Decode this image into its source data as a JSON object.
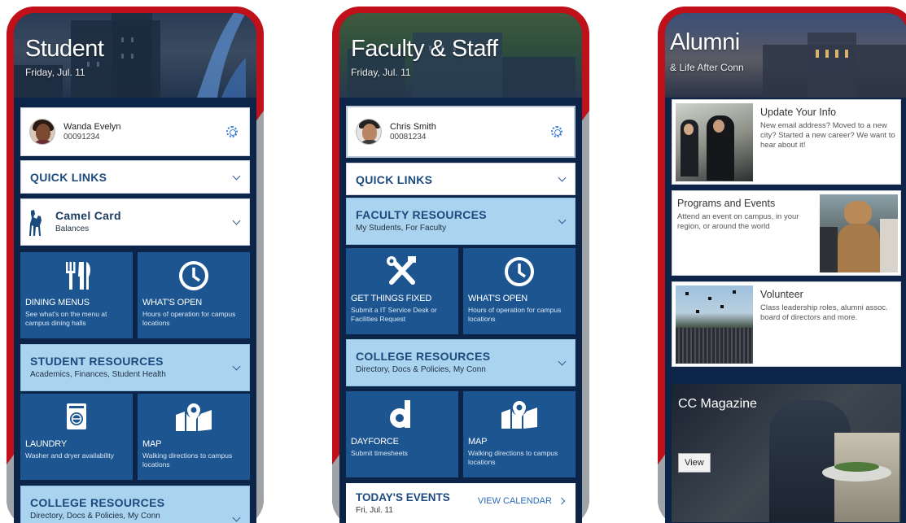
{
  "student": {
    "title": "Student",
    "date": "Friday, Jul. 11",
    "profile": {
      "name": "Wanda Evelyn",
      "id": "00091234"
    },
    "quick_links": "QUICK LINKS",
    "camel_card": {
      "title": "Camel Card",
      "subtitle": "Balances"
    },
    "tiles_top": [
      {
        "icon": "fork-knife-icon",
        "label": "DINING MENUS",
        "desc": "See what's on the menu at campus dining halls"
      },
      {
        "icon": "clock-icon",
        "label": "WHAT'S OPEN",
        "desc": "Hours of operation for campus locations"
      }
    ],
    "student_resources": {
      "title": "STUDENT RESOURCES",
      "subtitle": "Academics, Finances, Student Health"
    },
    "tiles_bottom": [
      {
        "icon": "washing-machine-icon",
        "label": "LAUNDRY",
        "desc": "Washer and dryer availability"
      },
      {
        "icon": "map-pin-icon",
        "label": "MAP",
        "desc": "Walking directions to campus locations"
      }
    ],
    "college_resources": {
      "title": "COLLEGE RESOURCES",
      "subtitle": "Directory, Docs & Policies, My Conn"
    }
  },
  "faculty": {
    "title": "Faculty & Staff",
    "date": "Friday, Jul. 11",
    "profile": {
      "name": "Chris Smith",
      "id": "00081234"
    },
    "quick_links": "QUICK LINKS",
    "faculty_resources": {
      "title": "FACULTY RESOURCES",
      "subtitle": "My Students, For Faculty"
    },
    "tiles_top": [
      {
        "icon": "wrench-screwdriver-icon",
        "label": "GET THINGS FIXED",
        "desc": "Submit a IT Service Desk or Facilities Request"
      },
      {
        "icon": "clock-icon",
        "label": "WHAT'S OPEN",
        "desc": "Hours of operation for campus locations"
      }
    ],
    "college_resources": {
      "title": "COLLEGE RESOURCES",
      "subtitle": "Directory, Docs & Policies, My Conn"
    },
    "tiles_bottom": [
      {
        "icon": "dayforce-logo-icon",
        "label": "DAYFORCE",
        "desc": "Submit timesheets"
      },
      {
        "icon": "map-pin-icon",
        "label": "MAP",
        "desc": "Walking directions to campus locations"
      }
    ],
    "events": {
      "title": "TODAY'S EVENTS",
      "date": "Fri, Jul. 11",
      "link": "VIEW CALENDAR"
    }
  },
  "alumni": {
    "title": "Alumni",
    "subtitle": "& Life After Conn",
    "cards": [
      {
        "title": "Update Your Info",
        "text": "New email address? Moved to a new city? Started a new career? We want to hear about it!"
      },
      {
        "title": "Programs and Events",
        "text": "Attend an event on campus, in your region, or around the world"
      },
      {
        "title": "Volunteer",
        "text": "Class leadership roles, alumni assoc. board of directors and more."
      }
    ],
    "magazine": {
      "title": "CC Magazine",
      "button": "View"
    }
  },
  "colors": {
    "brand_navy": "#0b2447",
    "tile_blue": "#1c5590",
    "light_blue": "#a9d3ee",
    "red": "#c0111a",
    "gray": "#9ea3a8"
  }
}
